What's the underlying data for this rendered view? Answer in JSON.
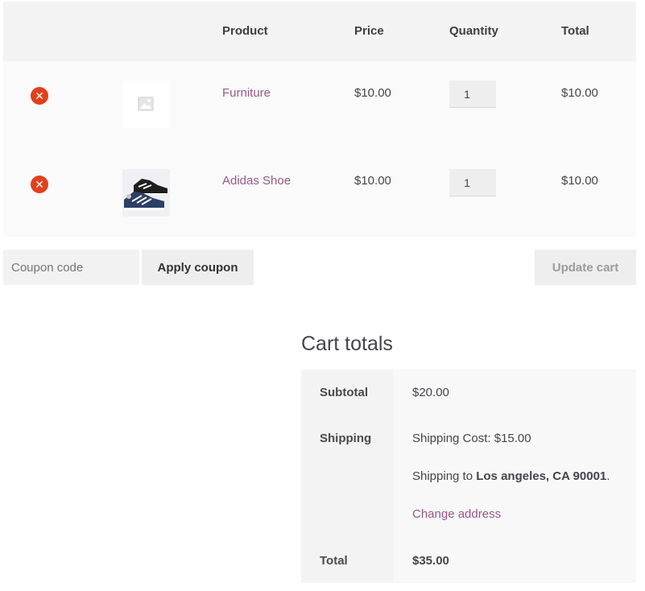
{
  "table": {
    "headers": {
      "product": "Product",
      "price": "Price",
      "quantity": "Quantity",
      "total": "Total"
    },
    "rows": [
      {
        "name": "Furniture",
        "price": "$10.00",
        "qty": "1",
        "total": "$10.00",
        "thumbnail": "placeholder-image-icon",
        "remove": "✕"
      },
      {
        "name": "Adidas Shoe",
        "price": "$10.00",
        "qty": "1",
        "total": "$10.00",
        "thumbnail": "shoe-image",
        "remove": "✕"
      }
    ]
  },
  "coupon": {
    "placeholder": "Coupon code",
    "apply_label": "Apply coupon"
  },
  "update_label": "Update cart",
  "totals": {
    "title": "Cart totals",
    "subtotal_label": "Subtotal",
    "subtotal_value": "$20.00",
    "shipping_label": "Shipping",
    "shipping_cost": "Shipping Cost: $15.00",
    "shipping_to_prefix": "Shipping to ",
    "shipping_to_address": "Los angeles, CA 90001",
    "shipping_to_suffix": ".",
    "change_address": "Change address",
    "total_label": "Total",
    "total_value": "$35.00"
  },
  "colors": {
    "accent": "#96588a",
    "remove": "#e2401c"
  }
}
